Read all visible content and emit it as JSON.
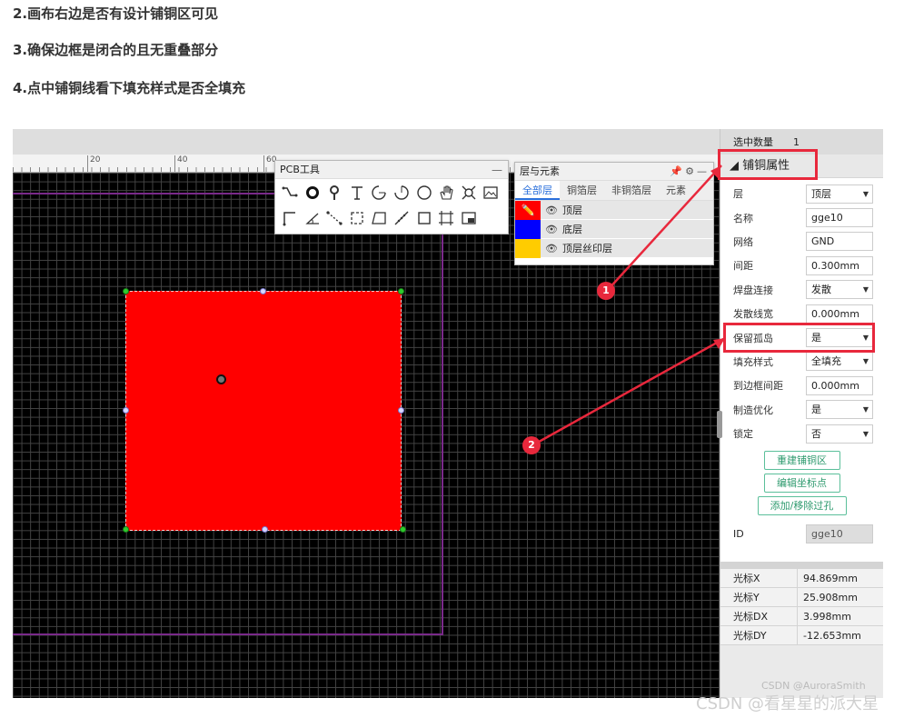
{
  "headings": [
    "2.画布右边是否有设计铺铜区可见",
    "3.确保边框是闭合的且无重叠部分",
    "4.点中铺铜线看下填充样式是否全填充"
  ],
  "ruler": {
    "labels": [
      "20",
      "40",
      "60"
    ]
  },
  "pcb_tools": {
    "title": "PCB工具",
    "minimize": "—",
    "tools": [
      "wire-icon",
      "via-icon",
      "pad-icon",
      "text-icon",
      "arc-icon",
      "arc2-icon",
      "circle-icon",
      "pan-icon",
      "hole-icon",
      "image-icon",
      "corner-icon",
      "angle-icon",
      "connect-icon",
      "rect-select-icon",
      "copper-area-icon",
      "measure-icon",
      "rect-icon",
      "solid-region-icon",
      "layout-icon"
    ]
  },
  "layers_panel": {
    "title": "层与元素",
    "tabs": [
      "全部层",
      "铜箔层",
      "非铜箔层",
      "元素"
    ],
    "active_tab": 0,
    "layers": [
      {
        "name": "顶层",
        "color": "#ff0000",
        "editing": true
      },
      {
        "name": "底层",
        "color": "#0000ff",
        "editing": false
      },
      {
        "name": "顶层丝印层",
        "color": "#ffcc00",
        "editing": false
      }
    ]
  },
  "side_panel": {
    "selected_label": "选中数量",
    "selected_count": "1",
    "group_title": "铺铜属性",
    "properties": [
      {
        "label": "层",
        "value": "顶层",
        "select": true
      },
      {
        "label": "名称",
        "value": "gge10",
        "select": false
      },
      {
        "label": "网络",
        "value": "GND",
        "select": false
      },
      {
        "label": "间距",
        "value": "0.300mm",
        "select": false
      },
      {
        "label": "焊盘连接",
        "value": "发散",
        "select": true
      },
      {
        "label": "发散线宽",
        "value": "0.000mm",
        "select": false
      },
      {
        "label": "保留孤岛",
        "value": "是",
        "select": true
      },
      {
        "label": "填充样式",
        "value": "全填充",
        "select": true
      },
      {
        "label": "到边框间距",
        "value": "0.000mm",
        "select": false
      },
      {
        "label": "制造优化",
        "value": "是",
        "select": true
      },
      {
        "label": "锁定",
        "value": "否",
        "select": true
      }
    ],
    "buttons": [
      "重建铺铜区",
      "编辑坐标点",
      "添加/移除过孔"
    ],
    "id_label": "ID",
    "id_value": "gge10",
    "cursor": [
      {
        "label": "光标X",
        "value": "94.869mm"
      },
      {
        "label": "光标Y",
        "value": "25.908mm"
      },
      {
        "label": "光标DX",
        "value": "3.998mm"
      },
      {
        "label": "光标DY",
        "value": "-12.653mm"
      }
    ]
  },
  "annotations": {
    "badge1": "1",
    "badge2": "2",
    "color": "#e8283c"
  },
  "watermarks": {
    "inner": "CSDN @AuroraSmith",
    "outer": "CSDN @看星星的派大星"
  }
}
